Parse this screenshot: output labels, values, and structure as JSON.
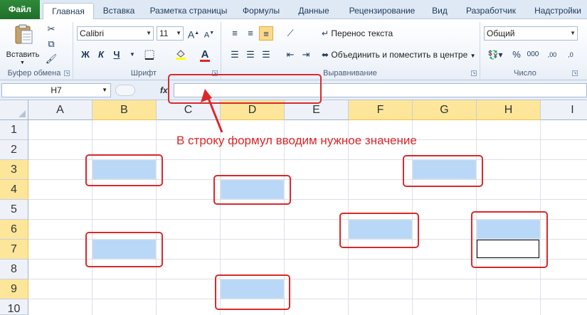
{
  "tabs": [
    "Файл",
    "Главная",
    "Вставка",
    "Разметка страницы",
    "Формулы",
    "Данные",
    "Рецензирование",
    "Вид",
    "Разработчик",
    "Надстройки"
  ],
  "clipboard": {
    "paste_label": "Вставить",
    "group_label": "Буфер обмена"
  },
  "font": {
    "name": "Calibri",
    "size": "11",
    "bold": "Ж",
    "italic": "К",
    "underline": "Ч",
    "grow": "A",
    "shrink": "A",
    "color_glyph": "A",
    "group_label": "Шрифт"
  },
  "alignment": {
    "wrap_label": "Перенос текста",
    "merge_label": "Объединить и поместить в центре",
    "group_label": "Выравнивание"
  },
  "number": {
    "format": "Общий",
    "percent": "%",
    "thousands": "000",
    "inc_decimal": ",00",
    "dec_decimal": ",0",
    "group_label": "Число"
  },
  "formula_bar": {
    "name_box": "H7",
    "fx": "fx",
    "value": ""
  },
  "columns": [
    "A",
    "B",
    "C",
    "D",
    "E",
    "F",
    "G",
    "H",
    "I"
  ],
  "selected_columns": [
    "B",
    "D",
    "F",
    "G",
    "H"
  ],
  "rows": [
    "1",
    "2",
    "3",
    "4",
    "5",
    "6",
    "7",
    "8",
    "9",
    "10"
  ],
  "selected_rows": [
    "3",
    "4",
    "6",
    "7",
    "9"
  ],
  "annotation": "В строку формул вводим нужное значение",
  "colors": {
    "accent_red": "#d9292b",
    "selection_fill": "#b9d7f7",
    "header_highlight": "#fde69a",
    "file_tab": "#2f8a3a"
  }
}
